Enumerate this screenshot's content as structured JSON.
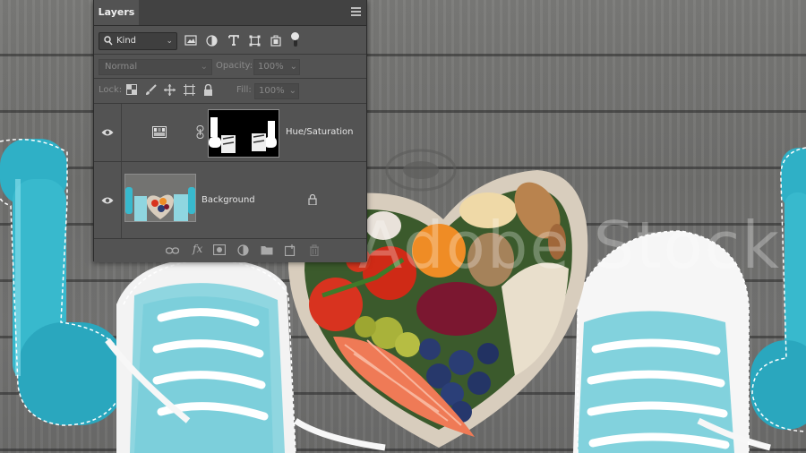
{
  "panel": {
    "tab_label": "Layers",
    "filter": {
      "kind_label": "Kind"
    },
    "blend_mode": "Normal",
    "opacity_label": "Opacity:",
    "opacity_value": "100%",
    "lock_label": "Lock:",
    "fill_label": "Fill:",
    "fill_value": "100%",
    "layers": [
      {
        "name": "Hue/Saturation",
        "type": "adjustment",
        "visible": true,
        "icon": "hue-saturation-icon"
      },
      {
        "name": "Background",
        "type": "pixel",
        "visible": true,
        "locked": true
      }
    ],
    "bottom_icons": [
      "link-layers-icon",
      "fx-icon",
      "add-mask-icon",
      "adjustment-layer-icon",
      "new-group-icon",
      "new-layer-icon",
      "trash-icon"
    ]
  },
  "canvas": {
    "watermark": "Adobe Stock",
    "accent_teal": "#3fb6c7",
    "selection": "marching-ants"
  },
  "colors": {
    "panel_bg": "#535353",
    "tabbar_bg": "#424242",
    "text": "#d6d6d6"
  }
}
